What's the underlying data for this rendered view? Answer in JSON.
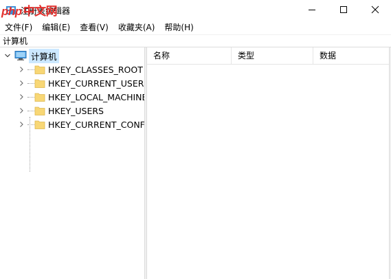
{
  "window": {
    "title": "注册表编辑器",
    "watermark_php": "php",
    "watermark_cn": "中文网"
  },
  "menu": [
    {
      "label": "文件(F)"
    },
    {
      "label": "编辑(E)"
    },
    {
      "label": "查看(V)"
    },
    {
      "label": "收藏夹(A)"
    },
    {
      "label": "帮助(H)"
    }
  ],
  "address": "计算机",
  "tree": {
    "root": "计算机",
    "keys": [
      {
        "label": "HKEY_CLASSES_ROOT"
      },
      {
        "label": "HKEY_CURRENT_USER"
      },
      {
        "label": "HKEY_LOCAL_MACHINE"
      },
      {
        "label": "HKEY_USERS"
      },
      {
        "label": "HKEY_CURRENT_CONFIG"
      }
    ]
  },
  "list": {
    "columns": [
      "名称",
      "类型",
      "数据"
    ]
  },
  "colors": {
    "selection": "#cce8ff",
    "folder": "#f8d775",
    "folder_edge": "#dcb64e"
  },
  "icons": [
    "regedit-icon",
    "minimize-icon",
    "maximize-icon",
    "close-icon",
    "chevron-down-icon",
    "chevron-right-icon",
    "computer-icon",
    "folder-icon"
  ]
}
